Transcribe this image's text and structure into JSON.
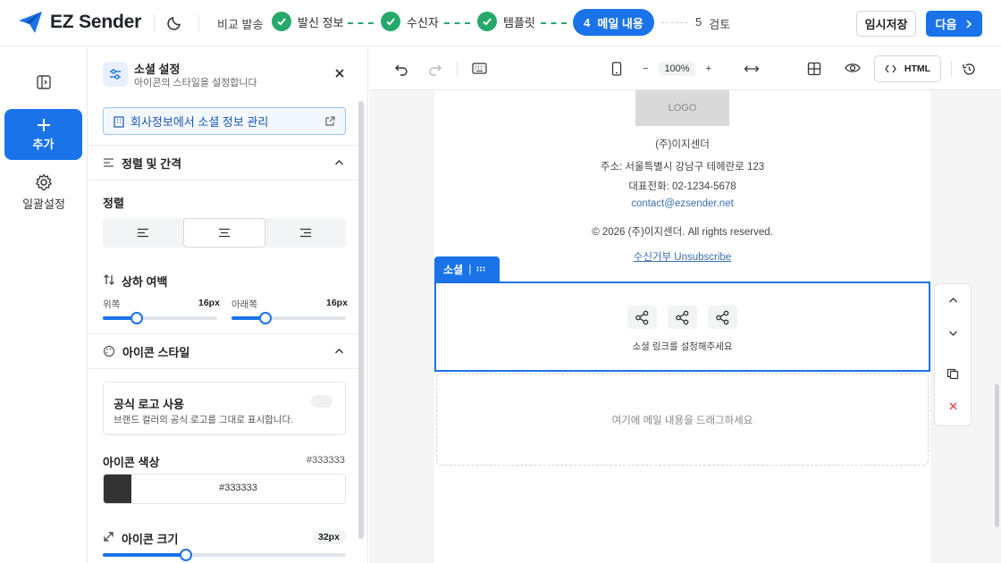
{
  "brand": {
    "name": "EZ Sender",
    "accent": "#1a73e8",
    "success": "#26a86a"
  },
  "steps": {
    "compare": "비교 발송",
    "items": [
      {
        "label": "발신 정보",
        "state": "done"
      },
      {
        "label": "수신자",
        "state": "done"
      },
      {
        "label": "템플릿",
        "state": "done"
      },
      {
        "num": "4",
        "label": "메일 내용",
        "state": "active"
      },
      {
        "num": "5",
        "label": "검토",
        "state": "pending"
      }
    ]
  },
  "header": {
    "temp_save": "임시저장",
    "next": "다음"
  },
  "rail": {
    "add": "추가",
    "bulk_settings": "일괄설정"
  },
  "panel": {
    "title": "소셜 설정",
    "subtitle": "아이콘의 스타일을 설정합니다",
    "company_link": "회사정보에서 소셜 정보 관리",
    "section_align": "정렬 및 간격",
    "align_label": "정렬",
    "align_options": [
      "left",
      "center",
      "right"
    ],
    "align_selected": "center",
    "padding_label": "상하 여백",
    "top_label": "위쪽",
    "top_value": "16px",
    "bottom_label": "아래쪽",
    "bottom_value": "16px",
    "section_icon": "아이콘 스타일",
    "official_logo_title": "공식 로고 사용",
    "official_logo_desc": "브랜드 컬러의 공식 로고를 그대로 표시합니다.",
    "official_logo_on": false,
    "icon_color_label": "아이콘 색상",
    "icon_color_value": "#333333",
    "icon_size_label": "아이콘 크기",
    "icon_size_value": "32px"
  },
  "toolbar": {
    "zoom": "100%",
    "html": "HTML"
  },
  "email": {
    "logo": "LOGO",
    "company": "(주)이지센더",
    "address": "주소: 서울특별시 강남구 테헤란로 123",
    "phone": "대표전화: 02-1234-5678",
    "contact": "contact@ezsender.net",
    "copyright": "© 2026 (주)이지센더. All rights reserved.",
    "unsubscribe": "수신거부 Unsubscribe",
    "block_tag": "소셜",
    "social_placeholder": "소셜 링크를 설정해주세요",
    "dropzone": "여기에 메일 내용을 드래그하세요"
  }
}
